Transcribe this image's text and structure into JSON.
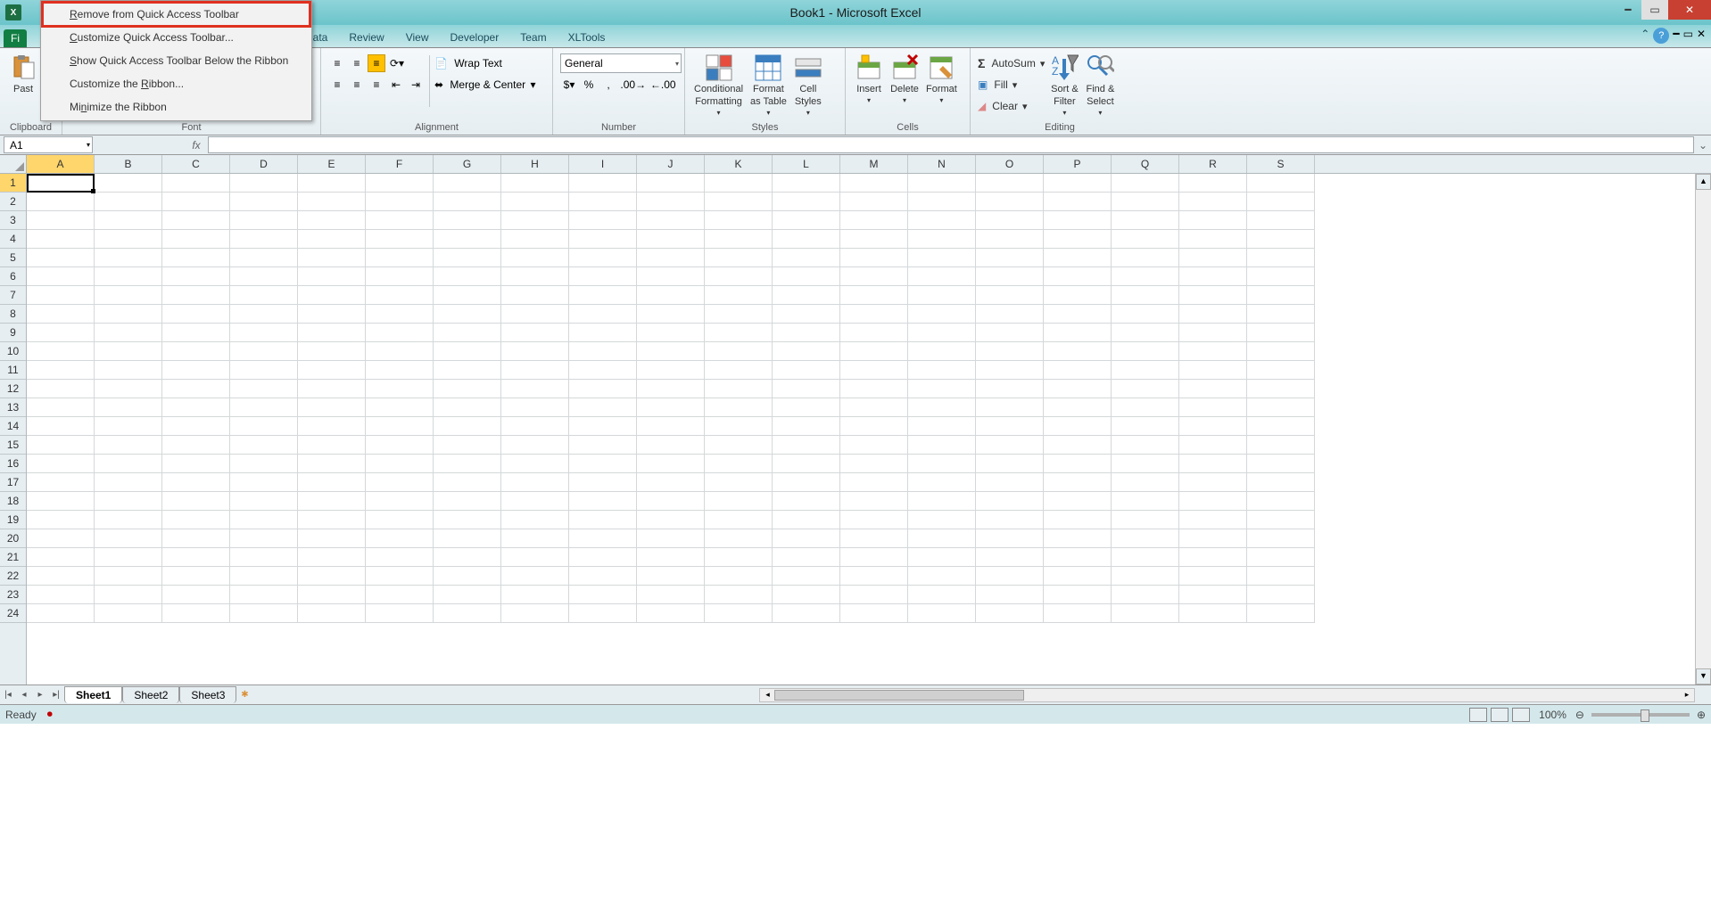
{
  "title": "Book1 - Microsoft Excel",
  "tabs": {
    "fi": "Fi",
    "data": "Data",
    "review": "Review",
    "view": "View",
    "developer": "Developer",
    "team": "Team",
    "xltools": "XLTools"
  },
  "context_menu": {
    "remove": "Remove from Quick Access Toolbar",
    "customize_qat": "Customize Quick Access Toolbar...",
    "show_below": "Show Quick Access Toolbar Below the Ribbon",
    "customize_ribbon": "Customize the Ribbon...",
    "minimize": "Minimize the Ribbon"
  },
  "groups": {
    "clipboard": "Clipboard",
    "font": "Font",
    "alignment": "Alignment",
    "number": "Number",
    "styles": "Styles",
    "cells": "Cells",
    "editing": "Editing"
  },
  "buttons": {
    "paste": "Past",
    "wrap": "Wrap Text",
    "merge": "Merge & Center",
    "general": "General",
    "cond": "Conditional",
    "cond2": "Formatting",
    "fmt": "Format",
    "fmt2": "as Table",
    "cell": "Cell",
    "cell2": "Styles",
    "insert": "Insert",
    "delete": "Delete",
    "format": "Format",
    "autosum": "AutoSum",
    "fill": "Fill",
    "clear": "Clear",
    "sort": "Sort &",
    "sort2": "Filter",
    "find": "Find &",
    "find2": "Select"
  },
  "namebox": "A1",
  "columns": [
    "A",
    "B",
    "C",
    "D",
    "E",
    "F",
    "G",
    "H",
    "I",
    "J",
    "K",
    "L",
    "M",
    "N",
    "O",
    "P",
    "Q",
    "R",
    "S"
  ],
  "rows": [
    "1",
    "2",
    "3",
    "4",
    "5",
    "6",
    "7",
    "8",
    "9",
    "10",
    "11",
    "12",
    "13",
    "14",
    "15",
    "16",
    "17",
    "18",
    "19",
    "20",
    "21",
    "22",
    "23",
    "24"
  ],
  "sheets": {
    "s1": "Sheet1",
    "s2": "Sheet2",
    "s3": "Sheet3"
  },
  "status": {
    "ready": "Ready",
    "zoom": "100%"
  }
}
